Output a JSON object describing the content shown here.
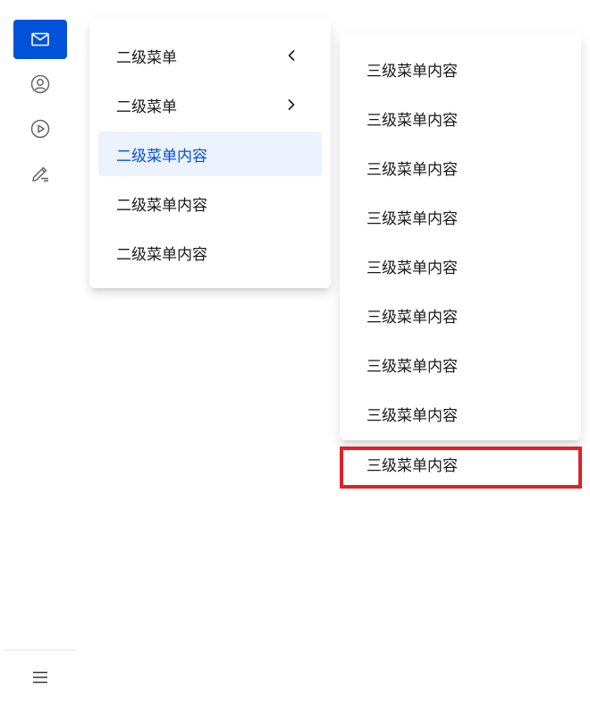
{
  "rail": {
    "icons": [
      {
        "name": "mail-icon",
        "active": true
      },
      {
        "name": "user-circle-icon",
        "active": false
      },
      {
        "name": "play-circle-icon",
        "active": false
      },
      {
        "name": "edit-icon",
        "active": false
      }
    ],
    "bottom_icon": "menu-icon"
  },
  "submenu": {
    "items": [
      {
        "label": "二级菜单",
        "chevron": "left"
      },
      {
        "label": "二级菜单",
        "chevron": "right"
      },
      {
        "label": "二级菜单内容",
        "active": true
      },
      {
        "label": "二级菜单内容"
      },
      {
        "label": "二级菜单内容"
      }
    ]
  },
  "thirdmenu": {
    "items": [
      {
        "label": "三级菜单内容"
      },
      {
        "label": "三级菜单内容"
      },
      {
        "label": "三级菜单内容"
      },
      {
        "label": "三级菜单内容"
      },
      {
        "label": "三级菜单内容"
      },
      {
        "label": "三级菜单内容"
      },
      {
        "label": "三级菜单内容"
      },
      {
        "label": "三级菜单内容"
      }
    ],
    "overflow_item": {
      "label": "三级菜单内容"
    }
  },
  "colors": {
    "brand": "#0052d9",
    "active_bg": "#ecf2fe",
    "highlight_border": "#e0202a"
  }
}
